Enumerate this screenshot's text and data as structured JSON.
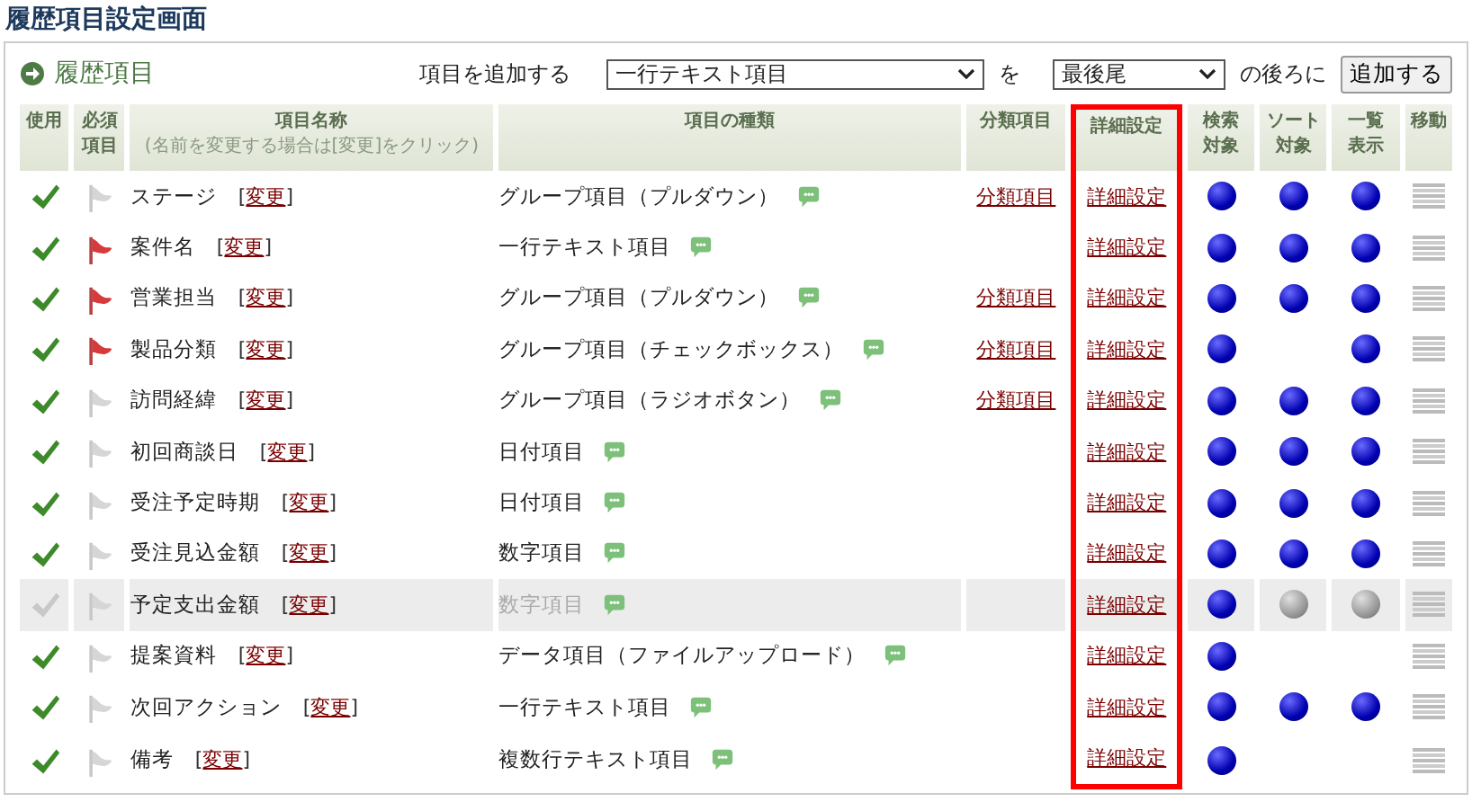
{
  "page_title": "履歴項目設定画面",
  "section": {
    "title": "履歴項目"
  },
  "add_bar": {
    "label": "項目を追加する",
    "type_select": "一行テキスト項目",
    "particle": "を",
    "position_select": "最後尾",
    "suffix": "の後ろに",
    "button": "追加する"
  },
  "table": {
    "columns": [
      {
        "label": "使用"
      },
      {
        "label": "必須項目"
      },
      {
        "label": "項目名称",
        "note": "(名前を変更する場合は[変更]をクリック)"
      },
      {
        "label": "項目の種類"
      },
      {
        "label": "分類項目"
      },
      {
        "label": "詳細設定",
        "highlighted": true
      },
      {
        "label": "検索対象"
      },
      {
        "label": "ソート対象"
      },
      {
        "label": "一覧表示"
      },
      {
        "label": "移動"
      }
    ],
    "rows": [
      {
        "used": true,
        "required": false,
        "name": "ステージ",
        "rename": "[変更]",
        "type": "グループ項目（プルダウン）",
        "category": "分類項目",
        "detail": "詳細設定",
        "search": {
          "on": true,
          "disabled": false
        },
        "sort": {
          "on": true,
          "disabled": false
        },
        "list": {
          "on": true,
          "disabled": false
        }
      },
      {
        "used": true,
        "required": true,
        "name": "案件名",
        "rename": "[変更]",
        "type": "一行テキスト項目",
        "detail": "詳細設定",
        "search": {
          "on": true,
          "disabled": false
        },
        "sort": {
          "on": true,
          "disabled": false
        },
        "list": {
          "on": true,
          "disabled": false
        }
      },
      {
        "used": true,
        "required": true,
        "name": "営業担当",
        "rename": "[変更]",
        "type": "グループ項目（プルダウン）",
        "category": "分類項目",
        "detail": "詳細設定",
        "search": {
          "on": true,
          "disabled": false
        },
        "sort": {
          "on": true,
          "disabled": false
        },
        "list": {
          "on": true,
          "disabled": false
        }
      },
      {
        "used": true,
        "required": true,
        "name": "製品分類",
        "rename": "[変更]",
        "type": "グループ項目（チェックボックス）",
        "category": "分類項目",
        "detail": "詳細設定",
        "search": {
          "on": true,
          "disabled": false
        },
        "sort": {
          "on": false
        },
        "list": {
          "on": true,
          "disabled": false
        }
      },
      {
        "used": true,
        "required": false,
        "name": "訪問経緯",
        "rename": "[変更]",
        "type": "グループ項目（ラジオボタン）",
        "category": "分類項目",
        "detail": "詳細設定",
        "search": {
          "on": true,
          "disabled": false
        },
        "sort": {
          "on": true,
          "disabled": false
        },
        "list": {
          "on": true,
          "disabled": false
        }
      },
      {
        "used": true,
        "required": false,
        "name": "初回商談日",
        "rename": "[変更]",
        "type": "日付項目",
        "detail": "詳細設定",
        "search": {
          "on": true,
          "disabled": false
        },
        "sort": {
          "on": true,
          "disabled": false
        },
        "list": {
          "on": true,
          "disabled": false
        }
      },
      {
        "used": true,
        "required": false,
        "name": "受注予定時期",
        "rename": "[変更]",
        "type": "日付項目",
        "detail": "詳細設定",
        "search": {
          "on": true,
          "disabled": false
        },
        "sort": {
          "on": true,
          "disabled": false
        },
        "list": {
          "on": true,
          "disabled": false
        }
      },
      {
        "used": true,
        "required": false,
        "name": "受注見込金額",
        "rename": "[変更]",
        "type": "数字項目",
        "detail": "詳細設定",
        "search": {
          "on": true,
          "disabled": false
        },
        "sort": {
          "on": true,
          "disabled": false
        },
        "list": {
          "on": true,
          "disabled": false
        }
      },
      {
        "used": false,
        "required": false,
        "name": "予定支出金額",
        "rename": "[変更]",
        "type": "数字項目",
        "detail": "詳細設定",
        "search": {
          "on": true,
          "disabled": false
        },
        "sort": {
          "on": true,
          "disabled": true
        },
        "list": {
          "on": true,
          "disabled": true
        }
      },
      {
        "used": true,
        "required": false,
        "name": "提案資料",
        "rename": "[変更]",
        "type": "データ項目（ファイルアップロード）",
        "detail": "詳細設定",
        "search": {
          "on": true,
          "disabled": false
        },
        "sort": {
          "on": false
        },
        "list": {
          "on": false
        }
      },
      {
        "used": true,
        "required": false,
        "name": "次回アクション",
        "rename": "[変更]",
        "type": "一行テキスト項目",
        "detail": "詳細設定",
        "search": {
          "on": true,
          "disabled": false
        },
        "sort": {
          "on": true,
          "disabled": false
        },
        "list": {
          "on": true,
          "disabled": false
        }
      },
      {
        "used": true,
        "required": false,
        "name": "備考",
        "rename": "[変更]",
        "type": "複数行テキスト項目",
        "detail": "詳細設定",
        "search": {
          "on": true,
          "disabled": false
        },
        "sort": {
          "on": false
        },
        "list": {
          "on": false
        }
      }
    ]
  }
}
